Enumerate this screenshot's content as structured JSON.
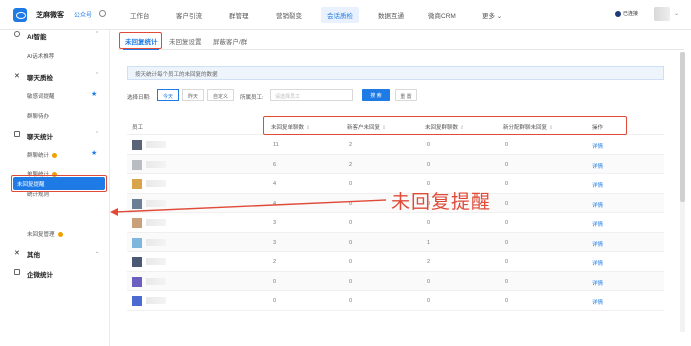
{
  "topbar": {
    "app_name": "芝麻微客",
    "pub_link": "公众号",
    "nav": [
      "工作台",
      "客户引流",
      "群管理",
      "营销裂变",
      "会话质检",
      "数据互通",
      "微商CRM",
      "更多 ⌄"
    ],
    "active_nav_index": 4,
    "status_text": "已连接"
  },
  "sidebar": {
    "groups": [
      {
        "label": "AI智能",
        "children": [
          {
            "label": "AI话术推荐"
          }
        ]
      },
      {
        "label": "聊天质检",
        "children": [
          {
            "label": "敏感词提醒"
          },
          {
            "label": "群聊待办"
          }
        ]
      },
      {
        "label": "聊天统计",
        "children": [
          {
            "label": "群聊统计"
          },
          {
            "label": "单聊统计"
          },
          {
            "label": "统计规则"
          },
          {
            "label": "未回复提醒"
          },
          {
            "label": "未回复管理"
          }
        ]
      },
      {
        "label": "其他",
        "children": []
      },
      {
        "label": "企微统计",
        "children": []
      }
    ]
  },
  "tabs": [
    "未回复统计",
    "未回复设置",
    "屏蔽客户/群"
  ],
  "notice": "按天统计每个员工的未回复的数据",
  "filters": {
    "date_label": "选择日期:",
    "dates": [
      "今天",
      "昨天",
      "自定义"
    ],
    "staff_label": "所属员工:",
    "staff_placeholder": "请选择员工",
    "search": "搜 索",
    "reset": "重 置"
  },
  "table": {
    "headers": [
      "员工",
      "未回复单聊数",
      "新客户未回复",
      "未回复群聊数",
      "新分配群聊未回复",
      "操作"
    ],
    "rows": [
      {
        "c1": "11",
        "c2": "2",
        "c3": "0",
        "c4": "0",
        "action": "详情"
      },
      {
        "c1": "6",
        "c2": "2",
        "c3": "0",
        "c4": "0",
        "action": "详情"
      },
      {
        "c1": "4",
        "c2": "0",
        "c3": "0",
        "c4": "0",
        "action": "详情"
      },
      {
        "c1": "4",
        "c2": "0",
        "c3": "0",
        "c4": "0",
        "action": "详情"
      },
      {
        "c1": "3",
        "c2": "0",
        "c3": "0",
        "c4": "0",
        "action": "详情"
      },
      {
        "c1": "3",
        "c2": "0",
        "c3": "1",
        "c4": "0",
        "action": "详情"
      },
      {
        "c1": "2",
        "c2": "0",
        "c3": "2",
        "c4": "0",
        "action": "详情"
      },
      {
        "c1": "0",
        "c2": "0",
        "c3": "0",
        "c4": "0",
        "action": "详情"
      },
      {
        "c1": "0",
        "c2": "0",
        "c3": "0",
        "c4": "0",
        "action": "详情"
      }
    ]
  },
  "callout": "未回复提醒",
  "colors": {
    "accent": "#1e7be6",
    "annotation": "#e04b38"
  }
}
